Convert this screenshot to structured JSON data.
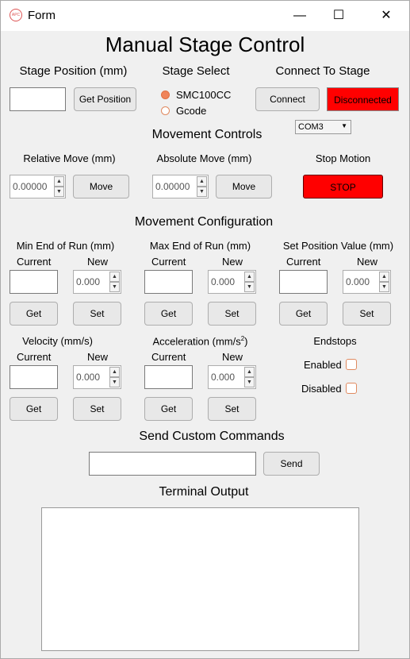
{
  "window": {
    "title": "Form",
    "minimize": "—",
    "maximize": "☐",
    "close": "✕"
  },
  "main_title": "Manual Stage Control",
  "stage_position": {
    "label": "Stage Position (mm)",
    "value": "",
    "button": "Get Position"
  },
  "stage_select": {
    "label": "Stage Select",
    "options": [
      "SMC100CC",
      "Gcode"
    ],
    "selected": "SMC100CC"
  },
  "connect": {
    "label": "Connect To Stage",
    "button": "Connect",
    "status": "Disconnected",
    "status_color": "#ff0000",
    "port": "COM3"
  },
  "movement_controls": {
    "heading": "Movement Controls",
    "relative": {
      "label": "Relative Move (mm)",
      "value": "0.00000",
      "button": "Move"
    },
    "absolute": {
      "label": "Absolute Move (mm)",
      "value": "0.00000",
      "button": "Move"
    },
    "stop": {
      "label": "Stop Motion",
      "button": "STOP",
      "color": "#ff0000"
    }
  },
  "configuration": {
    "heading": "Movement Configuration",
    "current_label": "Current",
    "new_label": "New",
    "get_label": "Get",
    "set_label": "Set",
    "min_end": {
      "label": "Min End of Run (mm)",
      "new_value": "0.000"
    },
    "max_end": {
      "label": "Max End of Run (mm)",
      "new_value": "0.000"
    },
    "set_position": {
      "label": "Set Position Value (mm)",
      "new_value": "0.000"
    },
    "velocity": {
      "label": "Velocity (mm/s)",
      "new_value": "0.000"
    },
    "acceleration": {
      "label": "Acceleration (mm/s",
      "label_sup": "2",
      "label_close": ")",
      "new_value": "0.000"
    },
    "endstops": {
      "label": "Endstops",
      "enabled": "Enabled",
      "disabled": "Disabled"
    }
  },
  "custom": {
    "heading": "Send Custom Commands",
    "value": "",
    "button": "Send"
  },
  "terminal": {
    "heading": "Terminal Output",
    "content": ""
  },
  "colors": {
    "radio_selected": "#f0845a",
    "checkbox_border": "#e08a60"
  }
}
